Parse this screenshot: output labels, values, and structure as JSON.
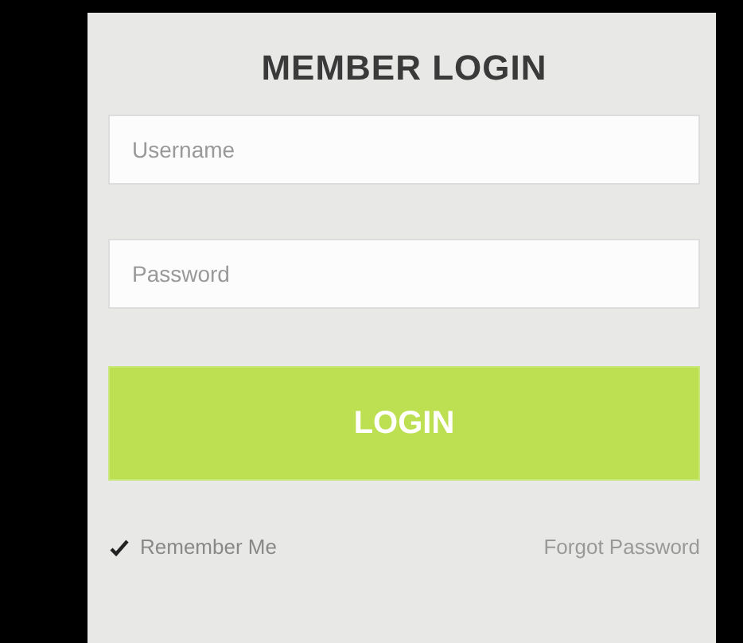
{
  "title": "MEMBER LOGIN",
  "fields": [
    {
      "placeholder": "Username"
    },
    {
      "placeholder": "Password"
    }
  ],
  "login_button": "LOGIN",
  "remember": {
    "label": "Remember Me",
    "checked": true
  },
  "forgot_link": "Forgot Password"
}
